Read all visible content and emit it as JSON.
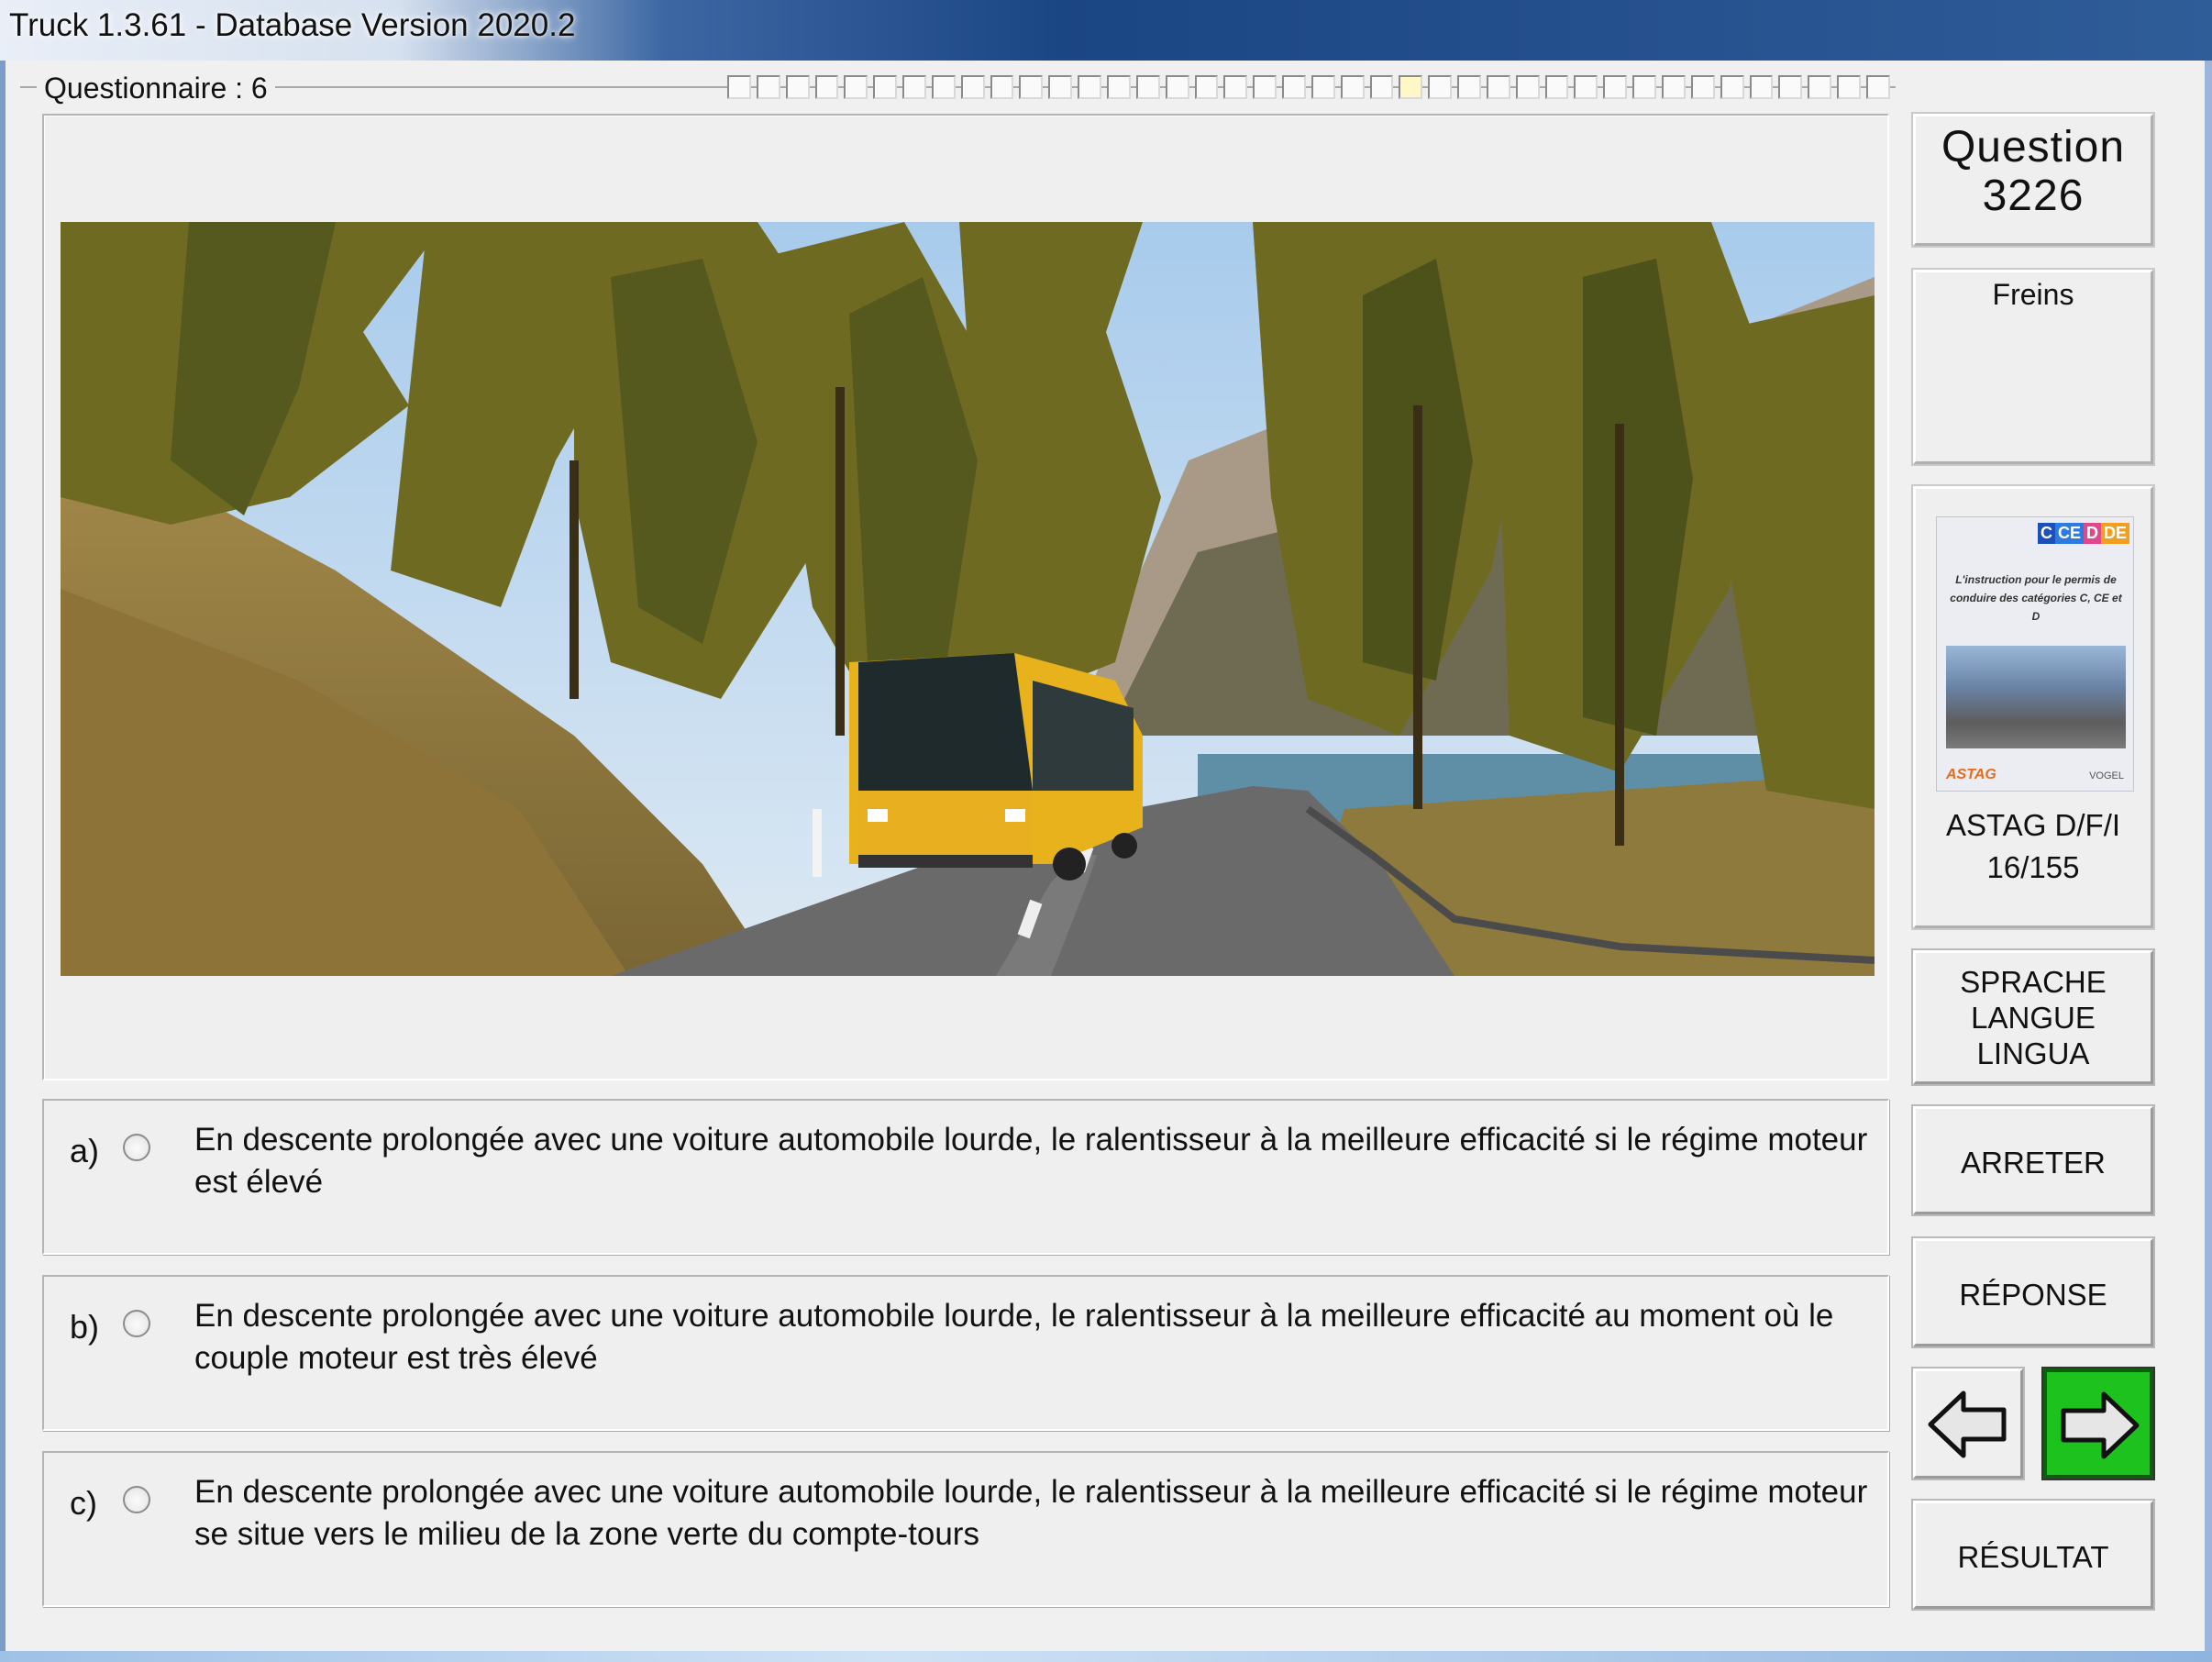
{
  "window": {
    "title": "Truck 1.3.61 - Database Version 2020.2"
  },
  "questionnaire": {
    "label": "Questionnaire : 6",
    "progress_total": 40,
    "progress_current_index": 23
  },
  "question": {
    "label": "Question",
    "number": "3226",
    "topic": "Freins"
  },
  "reference": {
    "cover_badges": [
      "C",
      "CE",
      "D",
      "DE"
    ],
    "cover_blurb": "L'instruction pour le permis de conduire des catégories C, CE et D",
    "cover_logo_left": "ASTAG",
    "cover_logo_right": "VOGEL",
    "line1": "ASTAG D/F/I",
    "line2": "16/155"
  },
  "answers": [
    {
      "letter": "a)",
      "text": "En descente prolongée avec une voiture automobile lourde, le ralentisseur à la meilleure efficacité si le régime moteur est élevé",
      "selected": false
    },
    {
      "letter": "b)",
      "text": "En descente prolongée avec une voiture automobile lourde, le ralentisseur à la meilleure efficacité au moment où le couple moteur est très élevé",
      "selected": false
    },
    {
      "letter": "c)",
      "text": "En descente prolongée avec une voiture automobile lourde, le ralentisseur à la meilleure efficacité si le régime moteur se situe vers le milieu de la zone verte du compte-tours",
      "selected": false
    }
  ],
  "buttons": {
    "language_line1": "SPRACHE",
    "language_line2": "LANGUE",
    "language_line3": "LINGUA",
    "stop": "ARRETER",
    "answer": "RÉPONSE",
    "result": "RÉSULTAT",
    "prev_icon": "arrow-left-icon",
    "next_icon": "arrow-right-icon"
  },
  "colors": {
    "next_button": "#1ec21e",
    "window_frame": "#1d3f72"
  }
}
